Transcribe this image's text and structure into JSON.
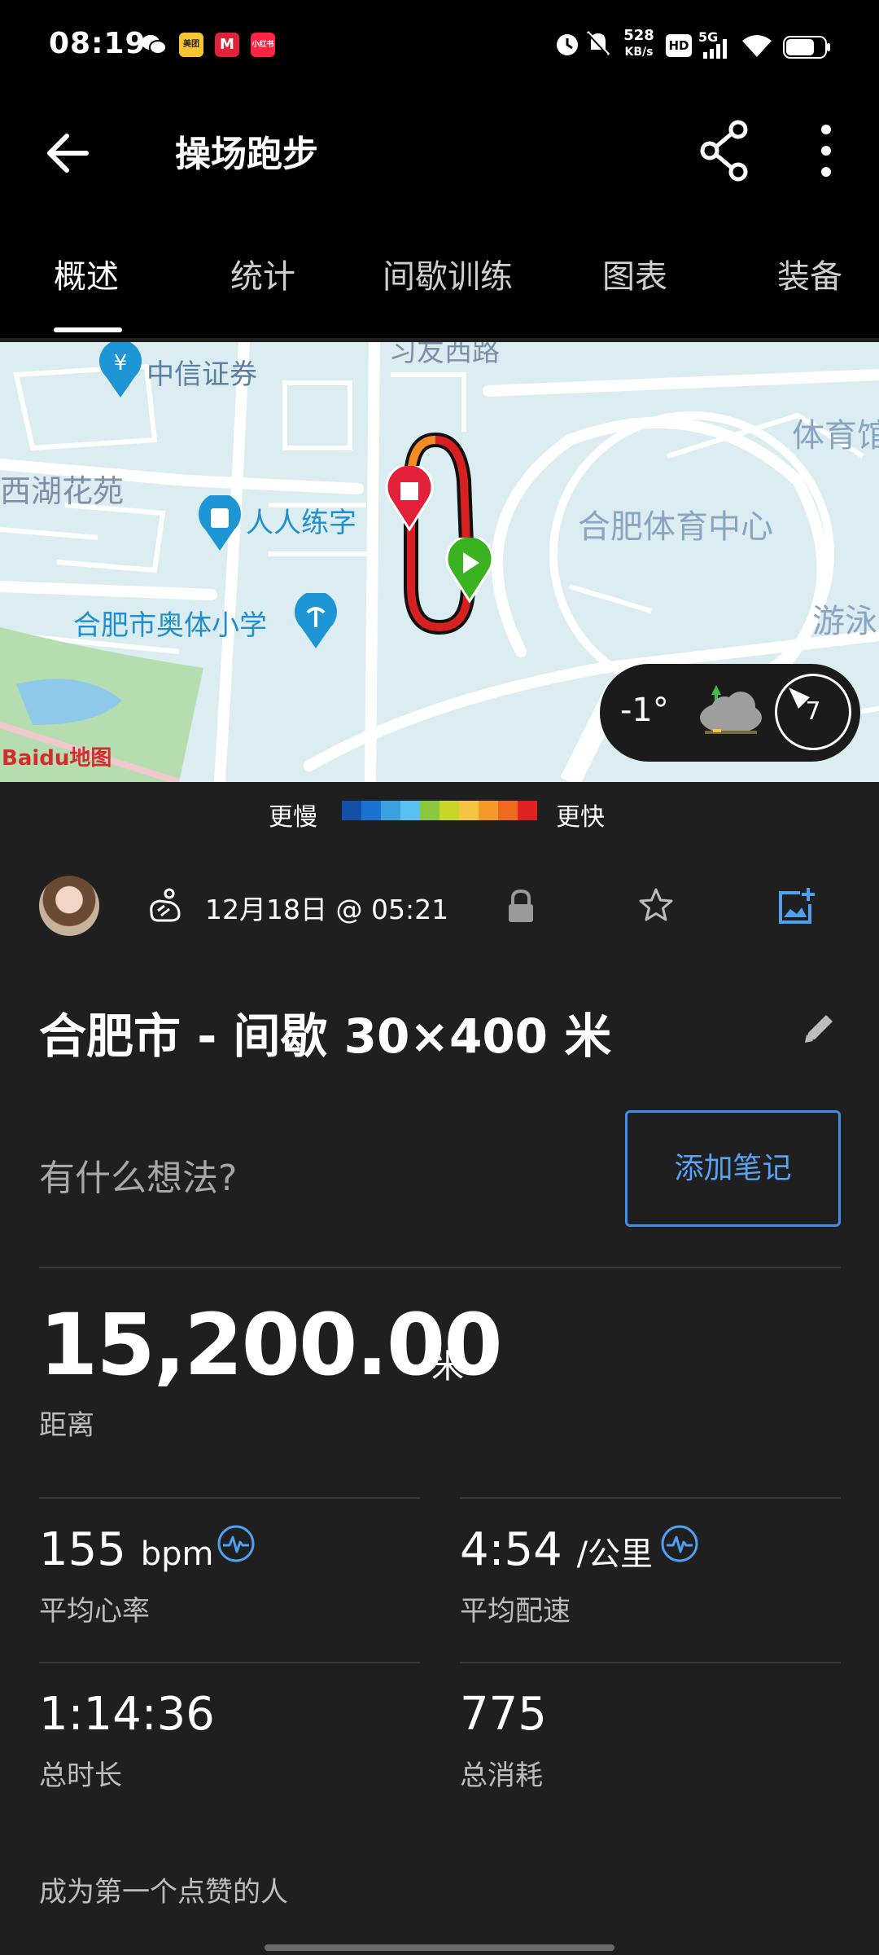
{
  "status_bar": {
    "time": "08:19",
    "app_badges": [
      "美团",
      "M",
      "小红书"
    ],
    "net_speed_top": "528",
    "net_speed_bottom": "KB/s",
    "hd": "HD",
    "network": "5G"
  },
  "app_bar": {
    "title": "操场跑步",
    "back_icon": "arrow-left-icon",
    "share_icon": "share-icon",
    "more_icon": "more-vert-icon"
  },
  "tabs": [
    {
      "label": "概述",
      "active": true
    },
    {
      "label": "统计",
      "active": false
    },
    {
      "label": "间歇训练",
      "active": false
    },
    {
      "label": "图表",
      "active": false
    },
    {
      "label": "装备",
      "active": false
    }
  ],
  "map": {
    "labels": {
      "zhongxin": "中信证券",
      "xiyou": "习友西路",
      "xihu": "西湖花苑",
      "renren": "人人练字",
      "tiyuzhongxin": "合肥体育中心",
      "aoti": "合肥市奥体小学",
      "tiyu_edge": "体育馆",
      "youyong": "游泳",
      "baidu": "Baidu地图"
    },
    "weather": {
      "temperature": "-1°",
      "icon": "cloud-icon",
      "wind": "7"
    }
  },
  "legend": {
    "slower": "更慢",
    "faster": "更快",
    "colors": [
      "#1450a8",
      "#1a73d0",
      "#3aa0e0",
      "#58c0f0",
      "#8cc63f",
      "#c8d62a",
      "#f5c542",
      "#f59a2a",
      "#f06a1e",
      "#e02222"
    ]
  },
  "activity": {
    "activity_icon": "running-icon",
    "date": "12月18日 @ 05:21",
    "title": "合肥市 - 间歇 30×400 米",
    "notes_placeholder": "有什么想法?",
    "add_note": "添加笔记"
  },
  "distance": {
    "value": "15,200.00",
    "unit": "米",
    "label": "距离"
  },
  "stats": {
    "avg_hr": {
      "value": "155",
      "unit": "bpm",
      "label": "平均心率"
    },
    "avg_pace": {
      "value": "4:54",
      "unit": "/公里",
      "label": "平均配速"
    },
    "duration": {
      "value": "1:14:36",
      "label": "总时长"
    },
    "calories": {
      "value": "775",
      "label": "总消耗"
    }
  },
  "likes": "成为第一个点赞的人",
  "colors": {
    "accent": "#3f8ee8",
    "background": "#1f1f1f",
    "bar": "#000000"
  }
}
